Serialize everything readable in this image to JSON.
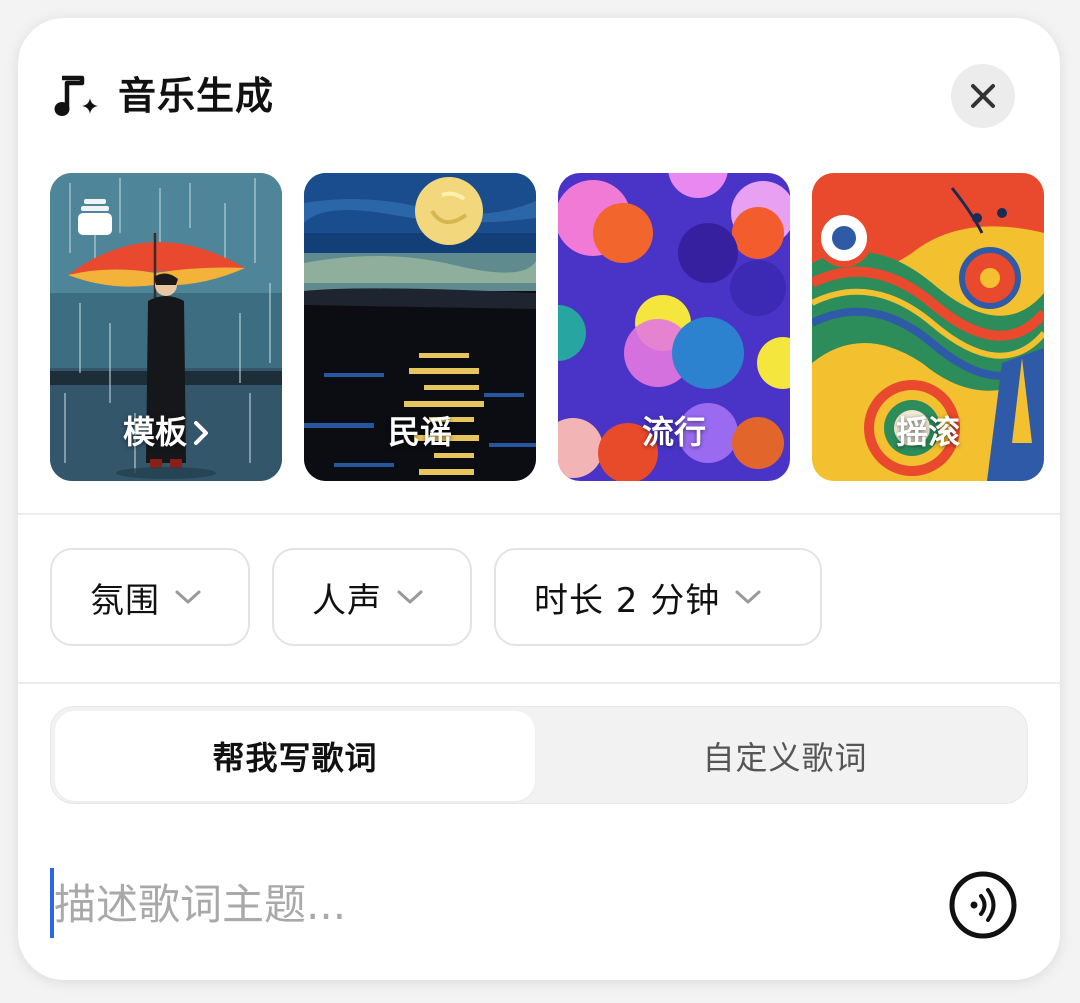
{
  "header": {
    "title": "音乐生成",
    "icon": "music-note-sparkle-icon",
    "close_icon": "close-icon"
  },
  "cards": [
    {
      "label": "模板",
      "has_chevron": true,
      "icon": "stack-icon"
    },
    {
      "label": "民谣"
    },
    {
      "label": "流行"
    },
    {
      "label": "摇滚"
    }
  ],
  "options": {
    "mood": "氛围",
    "vocal": "人声",
    "duration": "时长 2 分钟"
  },
  "lyrics_mode": {
    "active": "帮我写歌词",
    "inactive": "自定义歌词"
  },
  "input": {
    "placeholder": "描述歌词主题..."
  },
  "colors": {
    "accent": "#2f64e8",
    "chip_border": "#e3e3e3",
    "segment_bg": "#f2f2f2"
  }
}
